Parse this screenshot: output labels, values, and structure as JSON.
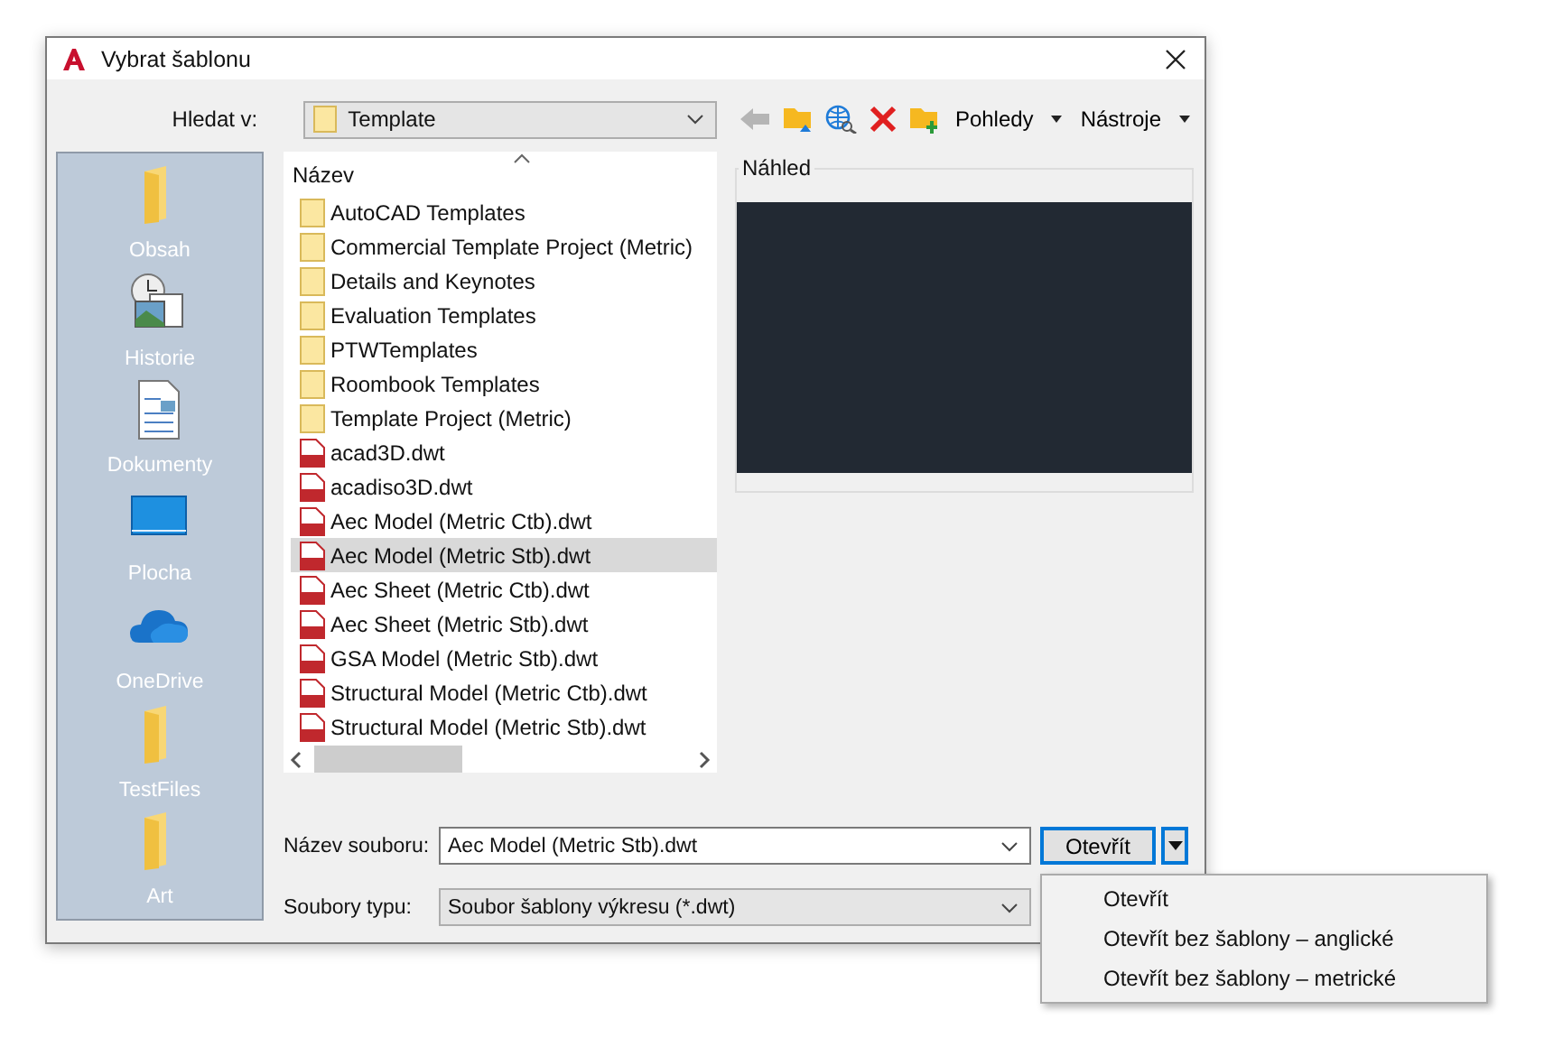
{
  "window": {
    "title": "Vybrat šablonu"
  },
  "look_in": {
    "label": "Hledat v:",
    "value": "Template"
  },
  "toolbar": {
    "back_disabled": true,
    "menus": [
      {
        "label": "Pohledy"
      },
      {
        "label": "Nástroje"
      }
    ]
  },
  "places": [
    {
      "label": "Obsah",
      "kind": "folder"
    },
    {
      "label": "Historie",
      "kind": "history"
    },
    {
      "label": "Dokumenty",
      "kind": "documents"
    },
    {
      "label": "Plocha",
      "kind": "desktop"
    },
    {
      "label": "OneDrive",
      "kind": "cloud"
    },
    {
      "label": "TestFiles",
      "kind": "folder"
    },
    {
      "label": "Art",
      "kind": "folder"
    }
  ],
  "file_list": {
    "column": "Název",
    "items": [
      {
        "name": "AutoCAD Templates",
        "kind": "folder",
        "selected": false
      },
      {
        "name": "Commercial Template Project (Metric)",
        "kind": "folder",
        "selected": false
      },
      {
        "name": "Details and Keynotes",
        "kind": "folder",
        "selected": false
      },
      {
        "name": "Evaluation Templates",
        "kind": "folder",
        "selected": false
      },
      {
        "name": "PTWTemplates",
        "kind": "folder",
        "selected": false
      },
      {
        "name": "Roombook Templates",
        "kind": "folder",
        "selected": false
      },
      {
        "name": "Template Project (Metric)",
        "kind": "folder",
        "selected": false
      },
      {
        "name": "acad3D.dwt",
        "kind": "template",
        "selected": false
      },
      {
        "name": "acadiso3D.dwt",
        "kind": "template",
        "selected": false
      },
      {
        "name": "Aec Model (Metric Ctb).dwt",
        "kind": "template",
        "selected": false
      },
      {
        "name": "Aec Model (Metric Stb).dwt",
        "kind": "template",
        "selected": true
      },
      {
        "name": "Aec Sheet (Metric Ctb).dwt",
        "kind": "template",
        "selected": false
      },
      {
        "name": "Aec Sheet (Metric Stb).dwt",
        "kind": "template",
        "selected": false
      },
      {
        "name": "GSA Model (Metric Stb).dwt",
        "kind": "template",
        "selected": false
      },
      {
        "name": "Structural Model (Metric Ctb).dwt",
        "kind": "template",
        "selected": false
      },
      {
        "name": "Structural Model (Metric Stb).dwt",
        "kind": "template",
        "selected": false
      }
    ]
  },
  "preview": {
    "label": "Náhled"
  },
  "file_name": {
    "label": "Název souboru:",
    "value": "Aec Model (Metric Stb).dwt"
  },
  "file_type": {
    "label": "Soubory typu:",
    "value": "Soubor šablony výkresu (*.dwt)"
  },
  "open_button": {
    "label": "Otevřít"
  },
  "open_menu": {
    "items": [
      "Otevřít",
      "Otevřít bez šablony – anglické",
      "Otevřít bez šablony – metrické"
    ]
  }
}
